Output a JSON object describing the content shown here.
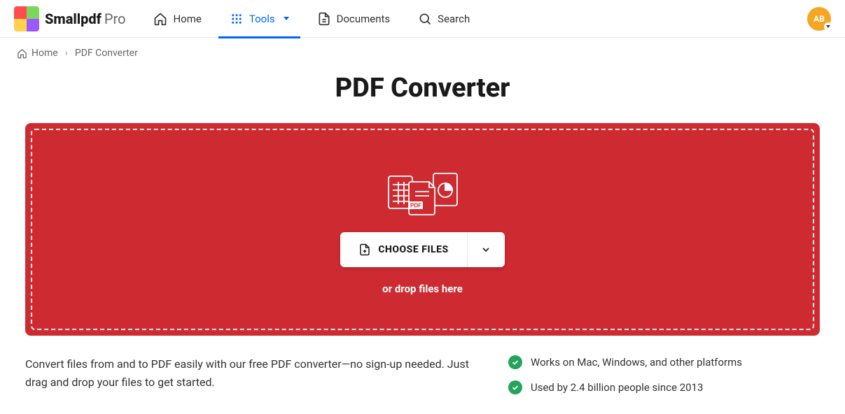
{
  "brand": {
    "name": "Smallpdf",
    "tier": "Pro",
    "logo_colors": [
      "#ff4d4d",
      "#7cd65c",
      "#ffd24d",
      "#9b59ff"
    ]
  },
  "nav": {
    "home": "Home",
    "tools": "Tools",
    "documents": "Documents",
    "search": "Search"
  },
  "user": {
    "initials": "AB",
    "avatar_color": "#f5a623"
  },
  "breadcrumb": {
    "home": "Home",
    "current": "PDF Converter"
  },
  "page": {
    "title": "PDF Converter"
  },
  "dropzone": {
    "bg_color": "#cd2b31",
    "pdf_badge": "PDF",
    "choose_label": "CHOOSE FILES",
    "hint": "or drop files here"
  },
  "description": "Convert files from and to PDF easily with our free PDF converter—no sign-up needed. Just drag and drop your files to get started.",
  "features": [
    "Works on Mac, Windows, and other platforms",
    "Used by 2.4 billion people since 2013"
  ]
}
